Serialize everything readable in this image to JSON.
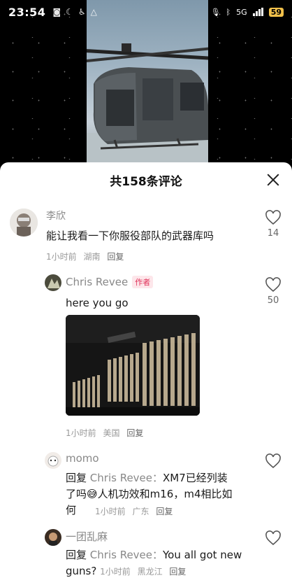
{
  "status_bar": {
    "time": "23:54",
    "left_icons": [
      "notification-icon",
      "moon-icon",
      "accessibility-icon",
      "warning-icon"
    ],
    "network": "5G",
    "battery": "59"
  },
  "comments_panel": {
    "title": "共158条评论",
    "comments": [
      {
        "user": "李欣",
        "text": "能让我看一下你服役部队的武器库吗",
        "time": "1小时前",
        "location": "湖南",
        "reply_label": "回复",
        "likes": "14"
      },
      {
        "user": "Chris Revee",
        "badge": "作者",
        "text": "here you go",
        "time": "1小时前",
        "location": "美国",
        "reply_label": "回复",
        "likes": "50"
      },
      {
        "user": "momo",
        "reply_prefix": "回复",
        "reply_to": "Chris Revee：",
        "text_line1": "XM7已经列装",
        "text_line2": "了吗",
        "text_line2b": "人机功效和m16，m4相比如",
        "text_line3": "何",
        "time": "1小时前",
        "location": "广东",
        "reply_label": "回复"
      },
      {
        "user": "一团乱麻",
        "reply_prefix": "回复",
        "reply_to": "Chris Revee：",
        "text_line1": "You all got new",
        "text_line2": "guns?",
        "time": "1小时前",
        "location": "黑龙江",
        "reply_label": "回复"
      }
    ]
  },
  "colors": {
    "author_badge": "#e0335a",
    "battery": "#f2c14b"
  }
}
